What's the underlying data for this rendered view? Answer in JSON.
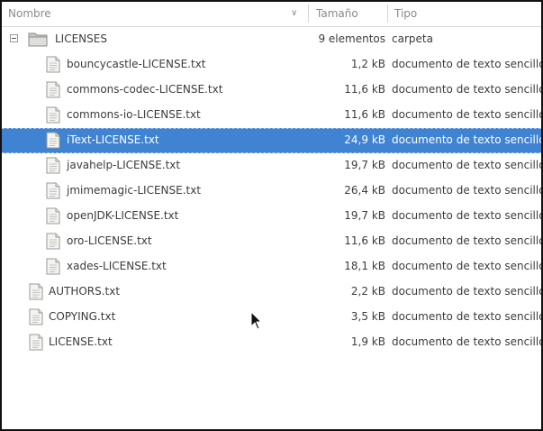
{
  "columns": {
    "name": "Nombre",
    "size": "Tamaño",
    "type": "Tipo"
  },
  "folder": {
    "name": "LICENSES",
    "size": "9 elementos",
    "type": "carpeta",
    "icon": "folder-icon"
  },
  "children": [
    {
      "name": "bouncycastle-LICENSE.txt",
      "size": "1,2 kB",
      "type": "documento de texto sencillo"
    },
    {
      "name": "commons-codec-LICENSE.txt",
      "size": "11,6 kB",
      "type": "documento de texto sencillo"
    },
    {
      "name": "commons-io-LICENSE.txt",
      "size": "11,6 kB",
      "type": "documento de texto sencillo"
    },
    {
      "name": "iText-LICENSE.txt",
      "size": "24,9 kB",
      "type": "documento de texto sencillo",
      "selected": true
    },
    {
      "name": "javahelp-LICENSE.txt",
      "size": "19,7 kB",
      "type": "documento de texto sencillo"
    },
    {
      "name": "jmimemagic-LICENSE.txt",
      "size": "26,4 kB",
      "type": "documento de texto sencillo"
    },
    {
      "name": "openJDK-LICENSE.txt",
      "size": "19,7 kB",
      "type": "documento de texto sencillo"
    },
    {
      "name": "oro-LICENSE.txt",
      "size": "11,6 kB",
      "type": "documento de texto sencillo"
    },
    {
      "name": "xades-LICENSE.txt",
      "size": "18,1 kB",
      "type": "documento de texto sencillo"
    }
  ],
  "files": [
    {
      "name": "AUTHORS.txt",
      "size": "2,2 kB",
      "type": "documento de texto sencillo"
    },
    {
      "name": "COPYING.txt",
      "size": "3,5 kB",
      "type": "documento de texto sencillo"
    },
    {
      "name": "LICENSE.txt",
      "size": "1,9 kB",
      "type": "documento de texto sencillo"
    }
  ],
  "colors": {
    "selection": "#3f83d2",
    "text": "#3c3c3c",
    "header_text": "#8a8a8a"
  }
}
